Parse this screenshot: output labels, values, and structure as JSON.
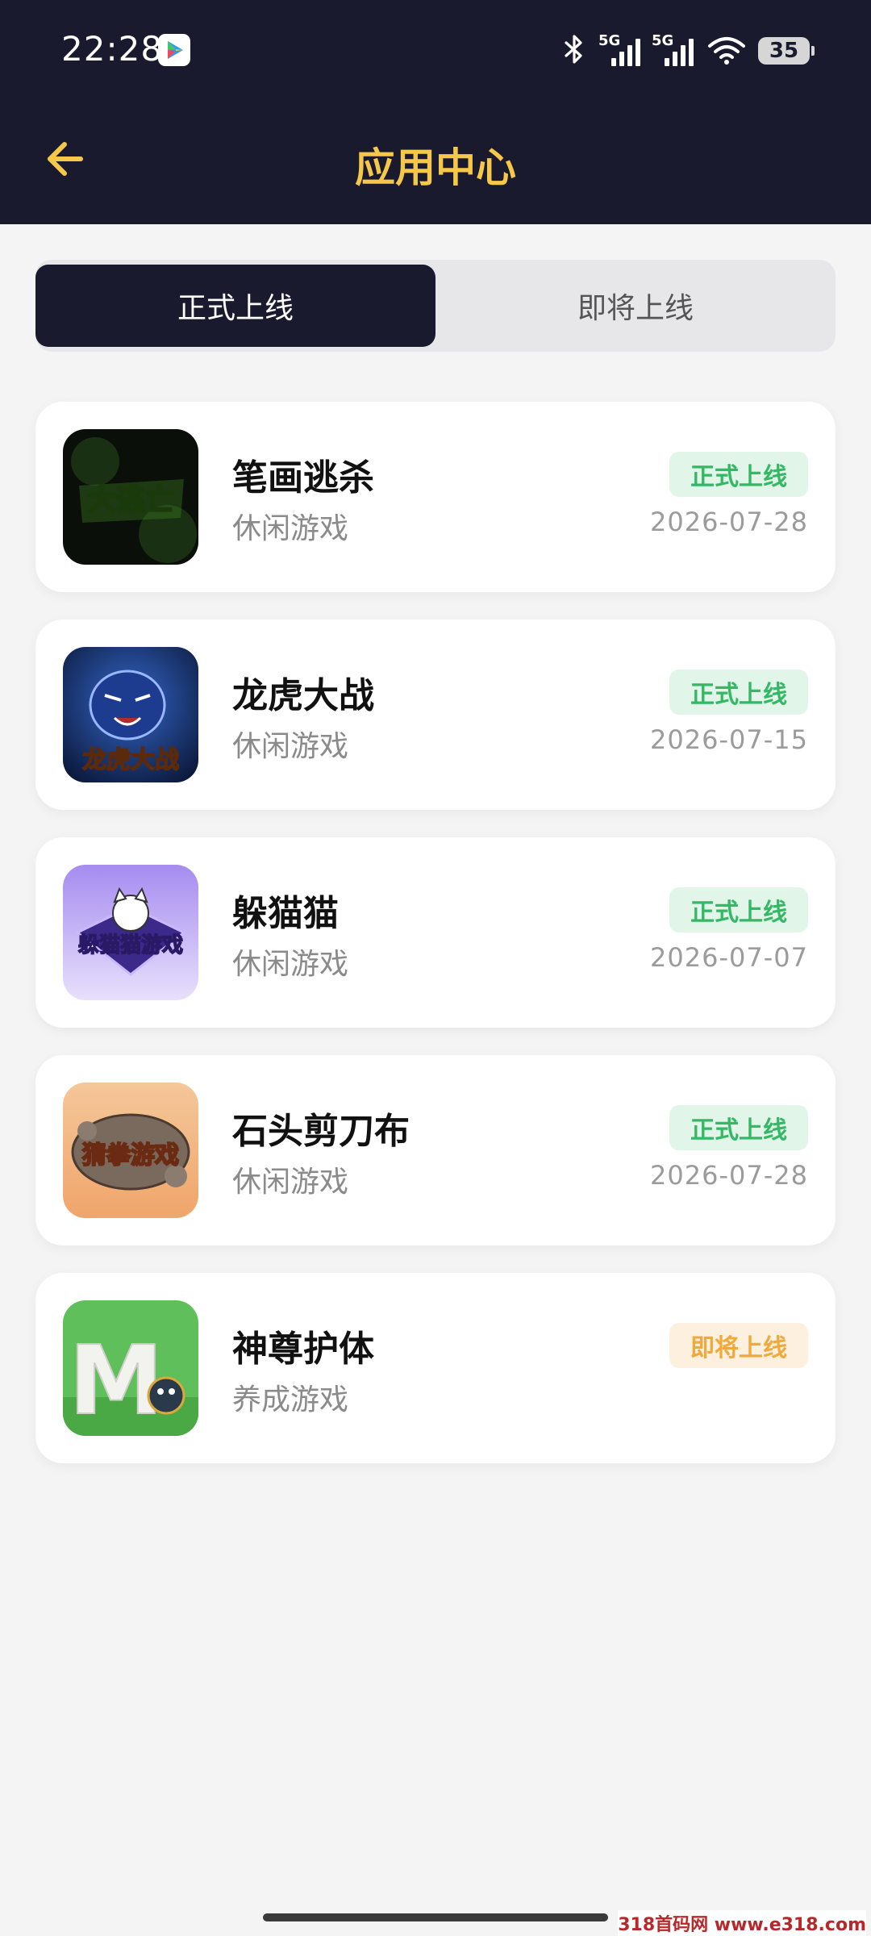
{
  "status_bar": {
    "time": "22:28",
    "network1": "5G",
    "network2": "5G",
    "battery": "35"
  },
  "header": {
    "title": "应用中心",
    "back_icon": "arrow-left-icon"
  },
  "tabs": [
    {
      "label": "正式上线",
      "active": true
    },
    {
      "label": "即将上线",
      "active": false
    }
  ],
  "apps": [
    {
      "name": "笔画逃杀",
      "category": "休闲游戏",
      "status": "正式上线",
      "date": "2026-07-28",
      "icon_text": "大逃亡"
    },
    {
      "name": "龙虎大战",
      "category": "休闲游戏",
      "status": "正式上线",
      "date": "2026-07-15",
      "icon_text": "龙虎大战"
    },
    {
      "name": "躲猫猫",
      "category": "休闲游戏",
      "status": "正式上线",
      "date": "2026-07-07",
      "icon_text": "躲猫猫游戏"
    },
    {
      "name": "石头剪刀布",
      "category": "休闲游戏",
      "status": "正式上线",
      "date": "2026-07-28",
      "icon_text": "猜拳游戏"
    },
    {
      "name": "神尊护体",
      "category": "养成游戏",
      "status": "即将上线",
      "date": "",
      "icon_text": "M"
    }
  ],
  "watermark": "318首码网 www.e318.com",
  "colors": {
    "header_bg": "#1a1a2e",
    "title": "#f5c84a",
    "live_badge_text": "#35b865",
    "soon_badge_text": "#f0a93a"
  }
}
